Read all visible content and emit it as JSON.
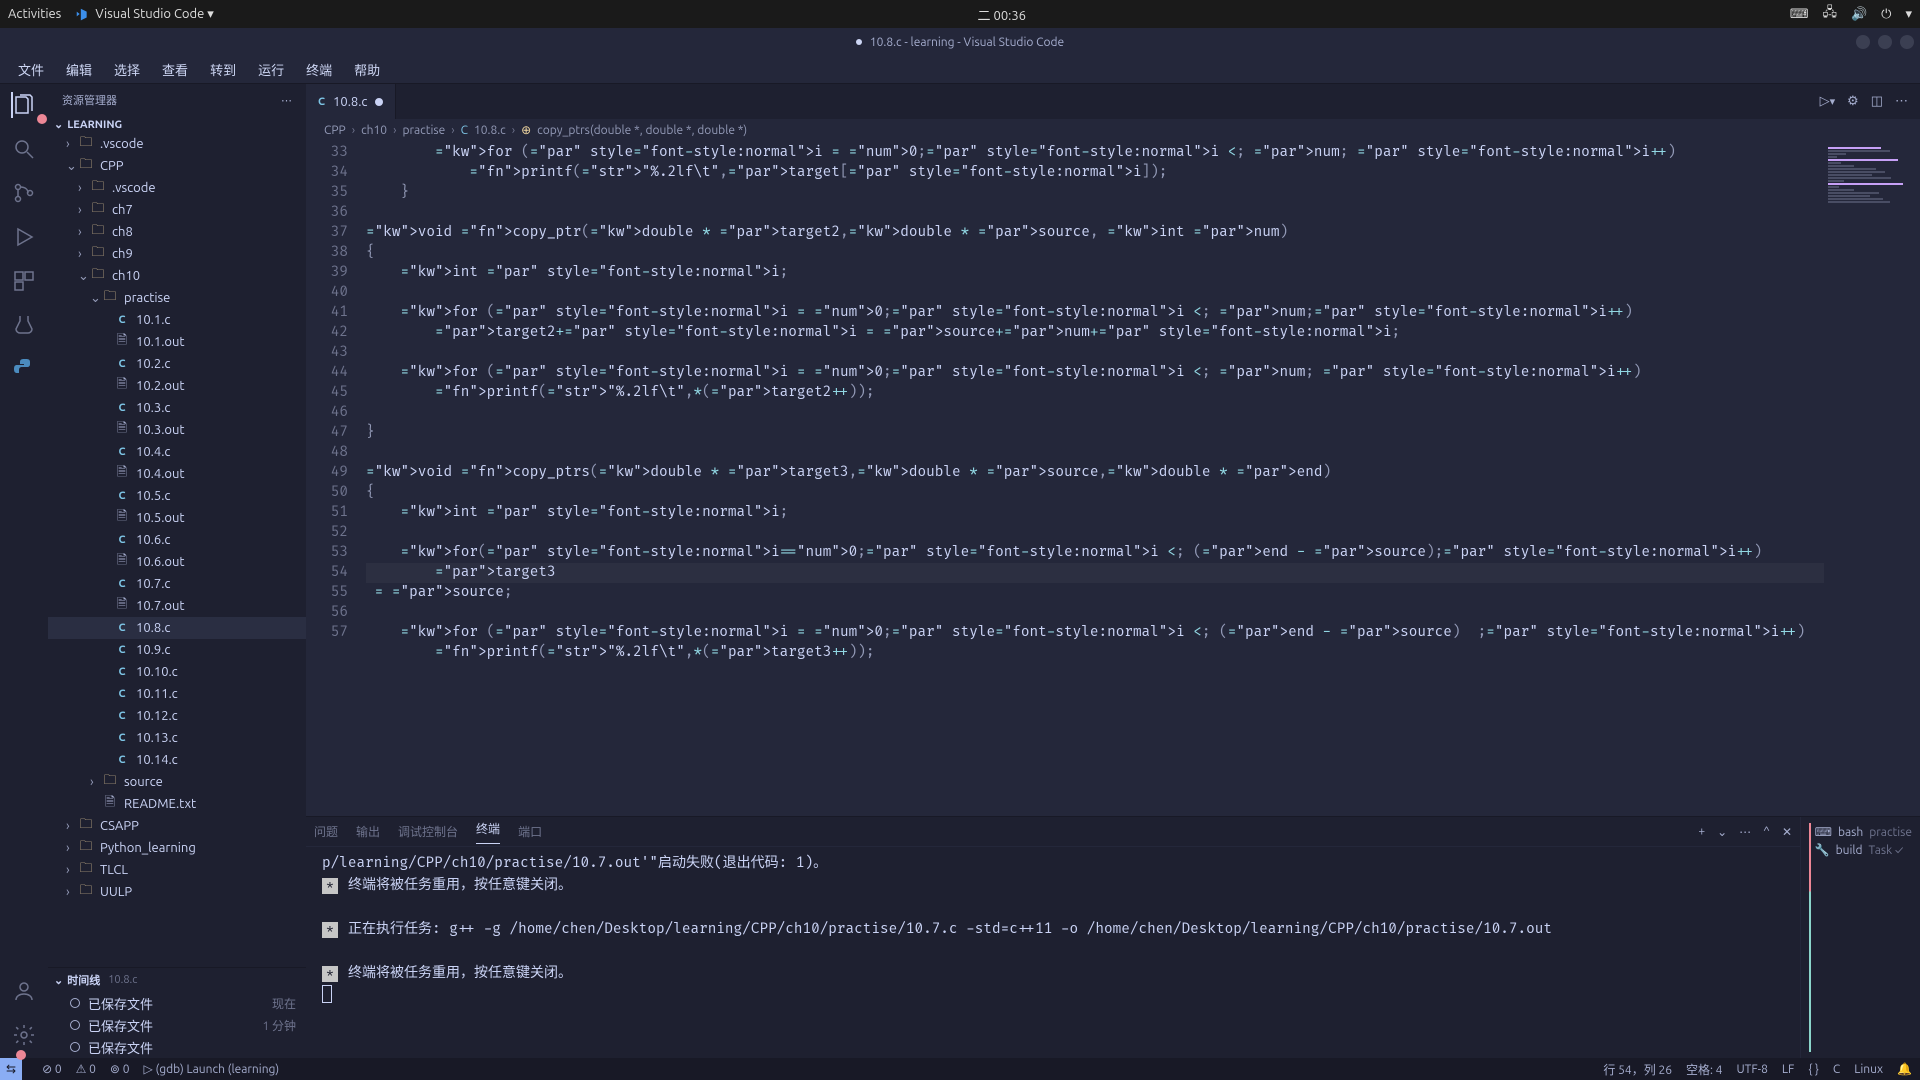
{
  "gnome": {
    "activities": "Activities",
    "app": "Visual Studio Code ▾",
    "clock": "二 00:36"
  },
  "titlebar": "10.8.c - learning - Visual Studio Code",
  "menu": [
    "文件",
    "编辑",
    "选择",
    "查看",
    "转到",
    "运行",
    "终端",
    "帮助"
  ],
  "sidebar": {
    "header": "资源管理器",
    "root": "LEARNING",
    "timeline_header": "时间线",
    "timeline_file": "10.8.c",
    "timeline": [
      {
        "label": "已保存文件",
        "when": "现在"
      },
      {
        "label": "已保存文件",
        "when": "1 分钟"
      },
      {
        "label": "已保存文件",
        "when": ""
      }
    ],
    "tree": [
      {
        "depth": 1,
        "chev": "›",
        "icon": "folder",
        "name": ".vscode"
      },
      {
        "depth": 1,
        "chev": "⌄",
        "icon": "folder",
        "name": "CPP"
      },
      {
        "depth": 2,
        "chev": "›",
        "icon": "folder",
        "name": ".vscode"
      },
      {
        "depth": 2,
        "chev": "›",
        "icon": "folder",
        "name": "ch7"
      },
      {
        "depth": 2,
        "chev": "›",
        "icon": "folder",
        "name": "ch8"
      },
      {
        "depth": 2,
        "chev": "›",
        "icon": "folder",
        "name": "ch9"
      },
      {
        "depth": 2,
        "chev": "⌄",
        "icon": "folder",
        "name": "ch10"
      },
      {
        "depth": 3,
        "chev": "⌄",
        "icon": "folder",
        "name": "practise"
      },
      {
        "depth": 4,
        "chev": "",
        "icon": "c",
        "name": "10.1.c"
      },
      {
        "depth": 4,
        "chev": "",
        "icon": "file",
        "name": "10.1.out"
      },
      {
        "depth": 4,
        "chev": "",
        "icon": "c",
        "name": "10.2.c"
      },
      {
        "depth": 4,
        "chev": "",
        "icon": "file",
        "name": "10.2.out"
      },
      {
        "depth": 4,
        "chev": "",
        "icon": "c",
        "name": "10.3.c"
      },
      {
        "depth": 4,
        "chev": "",
        "icon": "file",
        "name": "10.3.out"
      },
      {
        "depth": 4,
        "chev": "",
        "icon": "c",
        "name": "10.4.c"
      },
      {
        "depth": 4,
        "chev": "",
        "icon": "file",
        "name": "10.4.out"
      },
      {
        "depth": 4,
        "chev": "",
        "icon": "c",
        "name": "10.5.c"
      },
      {
        "depth": 4,
        "chev": "",
        "icon": "file",
        "name": "10.5.out"
      },
      {
        "depth": 4,
        "chev": "",
        "icon": "c",
        "name": "10.6.c"
      },
      {
        "depth": 4,
        "chev": "",
        "icon": "file",
        "name": "10.6.out"
      },
      {
        "depth": 4,
        "chev": "",
        "icon": "c",
        "name": "10.7.c"
      },
      {
        "depth": 4,
        "chev": "",
        "icon": "file",
        "name": "10.7.out"
      },
      {
        "depth": 4,
        "chev": "",
        "icon": "c",
        "name": "10.8.c",
        "selected": true
      },
      {
        "depth": 4,
        "chev": "",
        "icon": "c",
        "name": "10.9.c"
      },
      {
        "depth": 4,
        "chev": "",
        "icon": "c",
        "name": "10.10.c"
      },
      {
        "depth": 4,
        "chev": "",
        "icon": "c",
        "name": "10.11.c"
      },
      {
        "depth": 4,
        "chev": "",
        "icon": "c",
        "name": "10.12.c"
      },
      {
        "depth": 4,
        "chev": "",
        "icon": "c",
        "name": "10.13.c"
      },
      {
        "depth": 4,
        "chev": "",
        "icon": "c",
        "name": "10.14.c"
      },
      {
        "depth": 3,
        "chev": "›",
        "icon": "folder",
        "name": "source"
      },
      {
        "depth": 3,
        "chev": "",
        "icon": "readme",
        "name": "README.txt"
      },
      {
        "depth": 1,
        "chev": "›",
        "icon": "folder",
        "name": "CSAPP"
      },
      {
        "depth": 1,
        "chev": "›",
        "icon": "folder",
        "name": "Python_learning"
      },
      {
        "depth": 1,
        "chev": "›",
        "icon": "folder",
        "name": "TLCL"
      },
      {
        "depth": 1,
        "chev": "›",
        "icon": "folder",
        "name": "UULP"
      }
    ]
  },
  "tab": {
    "name": "10.8.c"
  },
  "breadcrumb": [
    "CPP",
    "ch10",
    "practise",
    "10.8.c",
    "copy_ptrs(double *, double *, double *)"
  ],
  "code_lines": {
    "33": "        for (i = 0;i < num; i++)",
    "34": "            printf(\"%.2lf\\t\",target[i]);",
    "35": "    }",
    "36": "",
    "37": "void copy_ptr(double * target2,double * source, int num)",
    "38": "{",
    "39": "    int i;",
    "40": "",
    "41": "    for (i = 0;i < num;i++)",
    "42": "        target2+i = source+num+i;",
    "43": "",
    "44": "    for (i = 0;i < num; i++)",
    "45": "        printf(\"%.2lf\\t\",*(target2++));",
    "46": "",
    "47": "}",
    "48": "",
    "49": "void copy_ptrs(double * target3,double * source,double * end)",
    "50": "{",
    "51": "    int i;",
    "52": "",
    "53": "    for(i=0;i < (end - source);i++)",
    "54": "        target3 = source;",
    "55": "",
    "56": "    for (i = 0;i < (end - source)  ;i++)",
    "57": "        printf(\"%.2lf\\t\",*(target3++));"
  },
  "panel": {
    "tabs": [
      "问题",
      "输出",
      "调试控制台",
      "终端",
      "端口"
    ],
    "lines": [
      "p/learning/CPP/ch10/practise/10.7.out'\"启动失败(退出代码: 1)。",
      " *  终端将被任务重用，按任意键关闭。",
      "",
      " *  正在执行任务: g++ -g /home/chen/Desktop/learning/CPP/ch10/practise/10.7.c -std=c++11 -o /home/chen/Desktop/learning/CPP/ch10/practise/10.7.out",
      "",
      " *  终端将被任务重用，按任意键关闭。"
    ],
    "terminals": [
      {
        "icon": "bash",
        "name": "bash",
        "sub": "practise"
      },
      {
        "icon": "tool",
        "name": "build",
        "sub": "Task ✓"
      }
    ]
  },
  "status": {
    "remote": "⇆",
    "errors": "⊘ 0",
    "warnings": "⚠ 0",
    "radio": "⊚ 0",
    "debug": "(gdb) Launch (learning)",
    "pos": "行 54，列 26",
    "spaces": "空格: 4",
    "enc": "UTF-8",
    "eol": "LF",
    "lang_icon": "{ }",
    "lang": "C",
    "os": "Linux",
    "bell": "🔔"
  }
}
